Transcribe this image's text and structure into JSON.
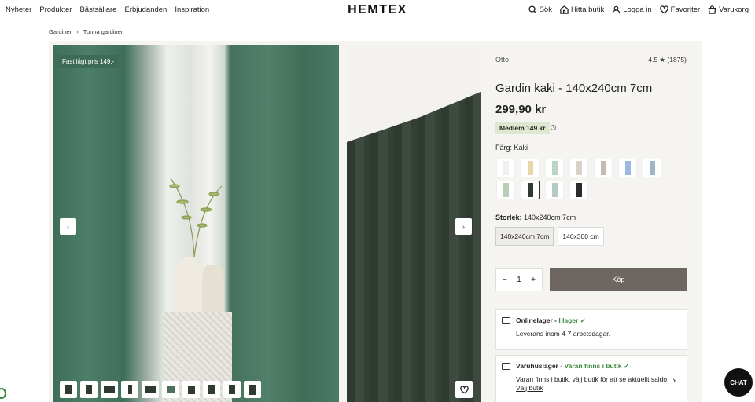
{
  "nav": {
    "left": [
      "Nyheter",
      "Produkter",
      "Bästsäljare",
      "Erbjudanden",
      "Inspiration"
    ],
    "logo": "HEMTEX",
    "right": [
      {
        "label": "Sök",
        "icon": "search-icon"
      },
      {
        "label": "Hitta butik",
        "icon": "store-icon"
      },
      {
        "label": "Logga in",
        "icon": "user-icon"
      },
      {
        "label": "Favoriter",
        "icon": "heart-icon"
      },
      {
        "label": "Varukorg",
        "icon": "bag-icon"
      }
    ]
  },
  "breadcrumb": [
    "Gardiner",
    "Tunna gardiner"
  ],
  "gallery": {
    "badge": "Fast lågt pris 149,-",
    "prev": "‹",
    "next": "›",
    "thumb_count": 10
  },
  "product": {
    "brand": "Otto",
    "rating": "4.5 ★",
    "reviews": "(1875)",
    "title": "Gardin kaki - 140x240cm 7cm",
    "price": "299,90 kr",
    "member_price": "Medlem 149 kr",
    "color_label": "Färg:",
    "color_value": "Kaki",
    "swatch_colors": [
      "#eef0ee",
      "#e8d6a8",
      "#bcd3c6",
      "#d9d2c6",
      "#c9b8b2",
      "#9db7e0",
      "#9fb4c8",
      "#b7cfb6",
      "#2f3a31",
      "#b6ccc3",
      "#2b2b2b"
    ],
    "size_label": "Storlek:",
    "size_value": "140x240cm 7cm",
    "sizes": [
      "140x240cm 7cm",
      "140x300 cm"
    ],
    "qty": "1",
    "buy": "Köp"
  },
  "stock": {
    "online_title": "Onlinelager -",
    "online_status": "I lager ✓",
    "online_desc": "Leverans inom 4-7 arbetsdagar.",
    "store_title": "Varuhuslager -",
    "store_status": "Varan finns i butik ✓",
    "store_desc": "Varan finns i butik, välj butik för att se aktuellt saldo",
    "store_link": "Välj butik"
  },
  "chat": "CHAT"
}
